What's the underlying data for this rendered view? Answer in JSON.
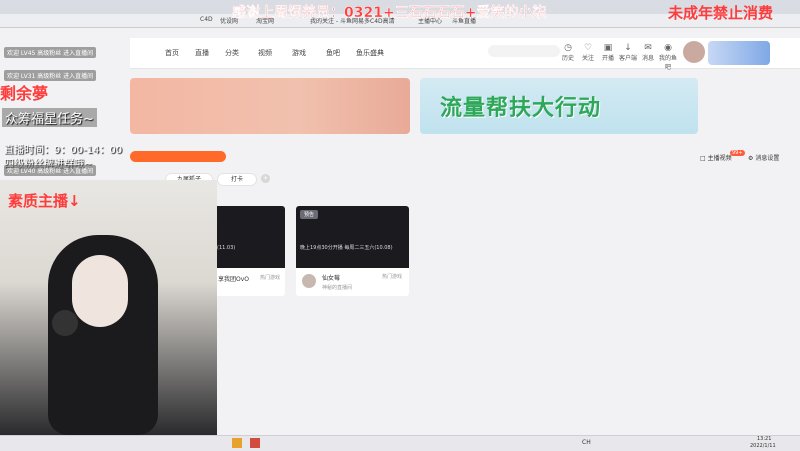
{
  "browser": {
    "bookmarks": [
      "C4D",
      "优设网",
      "淘宝网",
      "我的关注 - 斗鱼",
      "网易多C4D高清",
      "主播中心",
      "斗鱼直播"
    ]
  },
  "site": {
    "nav": [
      "首页",
      "直播",
      "分类",
      "视频",
      "游戏",
      "鱼吧",
      "鱼乐盛典"
    ],
    "header_icons": [
      "历史",
      "关注",
      "开播",
      "客户端",
      "消息",
      "我的鱼吧"
    ],
    "banner_right_title": "流量帮扶大行动",
    "right_links": [
      "主播视频",
      "消息设置"
    ],
    "right_badge": "99+",
    "filters": [
      "九尾狐子",
      "打卡"
    ],
    "cards": [
      {
        "badge": "预告",
        "thumb_text": "要求回方向(11.03)",
        "name": "享我团OvO",
        "tag": "热门游戏"
      },
      {
        "badge": "预告",
        "thumb_text": "晚上19点30分开播 每周二三五六(10.08)",
        "name": "仙女莓",
        "tag": "热门游戏",
        "sub": "神秘的直播间"
      }
    ]
  },
  "overlay": {
    "thanks_text": "感谢上周饲养员：0321+三石石石石+爱笑的小柒",
    "minor_notice": "未成年禁止消费",
    "left_red": "剩余夢",
    "task_text": "众筹福星任务~",
    "schedule_line": "直播时间：9：00-14：00",
    "group_line": "四级粉丝牌进群哦~",
    "streamer_label": "素质主播↓",
    "chat": [
      "欢迎 LV45 高级粉丝 进入直播间",
      "欢迎 LV31 高级粉丝 进入直播间",
      "欢迎 LV40 高级粉丝 进入直播间",
      "欢迎 进入直播间"
    ]
  },
  "taskbar": {
    "time": "13:21",
    "date": "2022/1/11",
    "ime": "CH"
  }
}
